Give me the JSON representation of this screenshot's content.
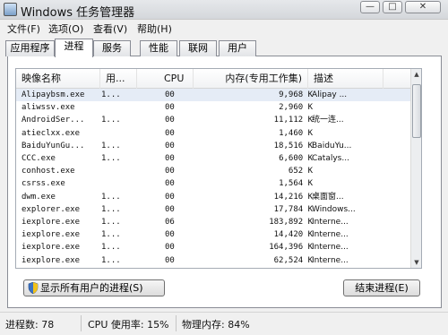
{
  "window": {
    "title": "Windows 任务管理器",
    "minimize": "—",
    "maximize": "□",
    "close": "✕"
  },
  "menu": [
    "文件(F)",
    "选项(O)",
    "查看(V)",
    "帮助(H)"
  ],
  "tabs": [
    "应用程序",
    "进程",
    "服务",
    "性能",
    "联网",
    "用户"
  ],
  "active_tab": "进程",
  "columns": {
    "name": "映像名称",
    "user": "用...",
    "cpu": "CPU",
    "memory": "内存(专用工作集)",
    "desc": "描述"
  },
  "processes": [
    {
      "name": "Alipaybsm.exe",
      "user": "1...",
      "cpu": "00",
      "memory": "9,968 K",
      "desc": "Alipay ..."
    },
    {
      "name": "aliwssv.exe",
      "user": "",
      "cpu": "00",
      "memory": "2,960 K",
      "desc": ""
    },
    {
      "name": "AndroidSer...",
      "user": "1...",
      "cpu": "00",
      "memory": "11,112 K",
      "desc": "统一连..."
    },
    {
      "name": "atieclxx.exe",
      "user": "",
      "cpu": "00",
      "memory": "1,460 K",
      "desc": ""
    },
    {
      "name": "BaiduYunGu...",
      "user": "1...",
      "cpu": "00",
      "memory": "18,516 K",
      "desc": "BaiduYu..."
    },
    {
      "name": "CCC.exe",
      "user": "1...",
      "cpu": "00",
      "memory": "6,600 K",
      "desc": "Catalys..."
    },
    {
      "name": "conhost.exe",
      "user": "",
      "cpu": "00",
      "memory": "652 K",
      "desc": ""
    },
    {
      "name": "csrss.exe",
      "user": "",
      "cpu": "00",
      "memory": "1,564 K",
      "desc": ""
    },
    {
      "name": "dwm.exe",
      "user": "1...",
      "cpu": "00",
      "memory": "14,216 K",
      "desc": "桌面窗..."
    },
    {
      "name": "explorer.exe",
      "user": "1...",
      "cpu": "00",
      "memory": "17,784 K",
      "desc": "Windows..."
    },
    {
      "name": "iexplore.exe",
      "user": "1...",
      "cpu": "06",
      "memory": "183,892 K",
      "desc": "Interne..."
    },
    {
      "name": "iexplore.exe",
      "user": "1...",
      "cpu": "00",
      "memory": "14,420 K",
      "desc": "Interne..."
    },
    {
      "name": "iexplore.exe",
      "user": "1...",
      "cpu": "00",
      "memory": "164,396 K",
      "desc": "Interne..."
    },
    {
      "name": "iexplore.exe",
      "user": "1...",
      "cpu": "00",
      "memory": "62,524 K",
      "desc": "Interne..."
    },
    {
      "name": "iexplore.exe",
      "user": "1...",
      "cpu": "00",
      "memory": "41,088 K",
      "desc": "Interne..."
    }
  ],
  "buttons": {
    "show_all": "显示所有用户的进程(S)",
    "end_process": "结束进程(E)"
  },
  "status": {
    "processes": "进程数: 78",
    "cpu": "CPU 使用率: 15%",
    "memory": "物理内存: 84%"
  },
  "colors": {
    "selected_row": "#e5ecf6",
    "accent": "#3c7fb1"
  }
}
